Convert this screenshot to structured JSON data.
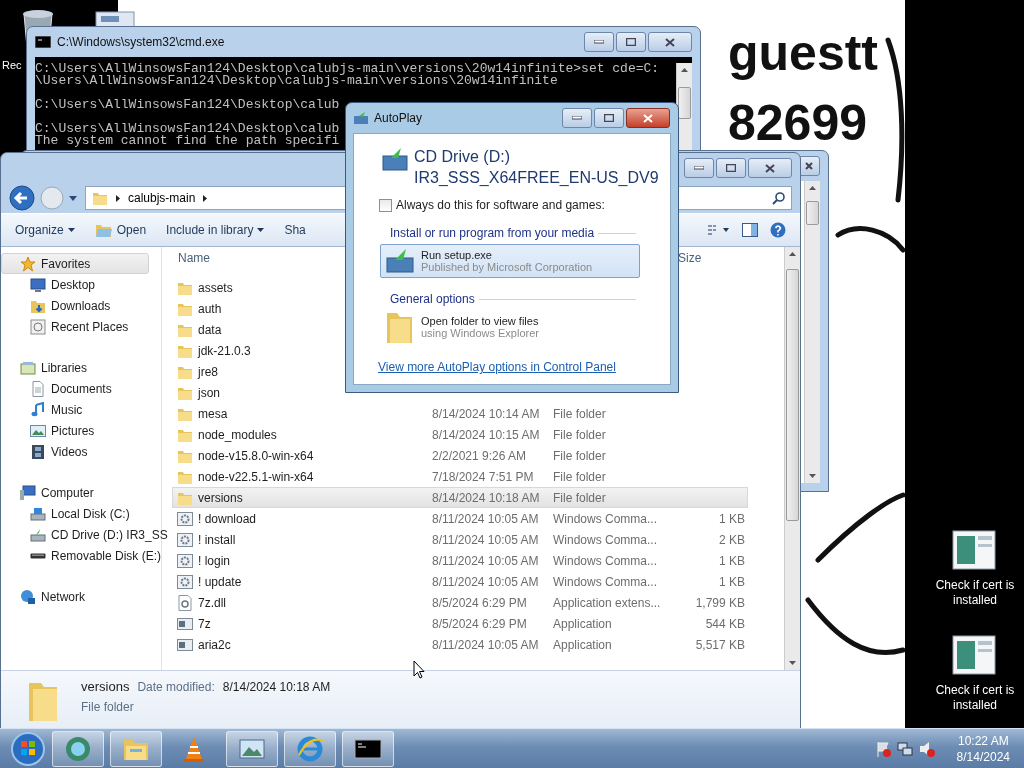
{
  "desktop": {
    "wallpaper_text": [
      "guestt",
      "82699"
    ],
    "left_icons": [
      {
        "label": "Rec"
      }
    ],
    "right_icons": [
      {
        "label": "Check if cert is installed"
      },
      {
        "label": "Check if cert is installed"
      }
    ]
  },
  "cmd_window": {
    "title": "C:\\Windows\\system32\\cmd.exe",
    "output": [
      {
        "lines": [
          "C:\\Users\\AllWinsowsFan124\\Desktop\\calubjs-main\\versions\\20w14infinite>set cde=C:",
          "\\Users\\AllWinsowsFan124\\Desktop\\calubjs-main\\versions\\20w14infinite"
        ]
      },
      {
        "lines": [
          "C:\\Users\\AllWinsowsFan124\\Desktop\\calub"
        ]
      },
      {
        "lines": [
          "C:\\Users\\AllWinsowsFan124\\Desktop\\calub",
          "The system cannot find the path specifi"
        ]
      }
    ]
  },
  "explorer": {
    "address": [
      "calubjs-main"
    ],
    "toolbar": [
      {
        "label": "Organize",
        "dropdown": true,
        "kind": "text"
      },
      {
        "label": "Open",
        "dropdown": false,
        "kind": "open"
      },
      {
        "label": "Include in library",
        "dropdown": true,
        "kind": "text"
      },
      {
        "label": "Sha",
        "dropdown": false,
        "kind": "text"
      }
    ],
    "nav": [
      {
        "label": "Favorites",
        "kind": "star",
        "selected": true,
        "children": [
          {
            "label": "Desktop",
            "kind": "desktop",
            "selected": false
          },
          {
            "label": "Downloads",
            "kind": "downloads",
            "selected": false
          },
          {
            "label": "Recent Places",
            "kind": "recent",
            "selected": false
          }
        ]
      },
      {
        "label": "Libraries",
        "kind": "libraries",
        "selected": false,
        "children": [
          {
            "label": "Documents",
            "kind": "documents",
            "selected": false
          },
          {
            "label": "Music",
            "kind": "music",
            "selected": false
          },
          {
            "label": "Pictures",
            "kind": "pictures",
            "selected": false
          },
          {
            "label": "Videos",
            "kind": "videos",
            "selected": false
          }
        ]
      },
      {
        "label": "Computer",
        "kind": "computer",
        "selected": false,
        "children": [
          {
            "label": "Local Disk (C:)",
            "kind": "disk",
            "selected": false
          },
          {
            "label": "CD Drive (D:) IR3_SS",
            "kind": "cd",
            "selected": false
          },
          {
            "label": "Removable Disk (E:)",
            "kind": "removable",
            "selected": false
          }
        ]
      },
      {
        "label": "Network",
        "kind": "network",
        "selected": false
      }
    ],
    "columns": [
      {
        "label": "Name"
      },
      {
        "label": "Size"
      }
    ],
    "rows": [
      {
        "name": "assets",
        "kind": "folder",
        "selected": false
      },
      {
        "name": "auth",
        "kind": "folder",
        "selected": false
      },
      {
        "name": "data",
        "kind": "folder",
        "selected": false
      },
      {
        "name": "jdk-21.0.3",
        "kind": "folder",
        "selected": false
      },
      {
        "name": "jre8",
        "kind": "folder",
        "selected": false
      },
      {
        "name": "json",
        "kind": "folder",
        "selected": false
      },
      {
        "name": "mesa",
        "kind": "folder",
        "modified": "8/14/2024 10:14 AM",
        "type": "File folder",
        "selected": false
      },
      {
        "name": "node_modules",
        "kind": "folder",
        "modified": "8/14/2024 10:15 AM",
        "type": "File folder",
        "selected": false
      },
      {
        "name": "node-v15.8.0-win-x64",
        "kind": "folder",
        "modified": "2/2/2021 9:26 AM",
        "type": "File folder",
        "selected": false
      },
      {
        "name": "node-v22.5.1-win-x64",
        "kind": "folder",
        "modified": "7/18/2024 7:51 PM",
        "type": "File folder",
        "selected": false
      },
      {
        "name": "versions",
        "kind": "folder",
        "modified": "8/14/2024 10:18 AM",
        "type": "File folder",
        "selected": true
      },
      {
        "name": "! download",
        "kind": "script",
        "modified": "8/11/2024 10:05 AM",
        "type": "Windows Comma...",
        "size": "1 KB",
        "selected": false
      },
      {
        "name": "! install",
        "kind": "script",
        "modified": "8/11/2024 10:05 AM",
        "type": "Windows Comma...",
        "size": "2 KB",
        "selected": false
      },
      {
        "name": "! login",
        "kind": "script",
        "modified": "8/11/2024 10:05 AM",
        "type": "Windows Comma...",
        "size": "1 KB",
        "selected": false
      },
      {
        "name": "! update",
        "kind": "script",
        "modified": "8/11/2024 10:05 AM",
        "type": "Windows Comma...",
        "size": "1 KB",
        "selected": false
      },
      {
        "name": "7z.dll",
        "kind": "dll",
        "modified": "8/5/2024 6:29 PM",
        "type": "Application extens...",
        "size": "1,799 KB",
        "selected": false
      },
      {
        "name": "7z",
        "kind": "app",
        "modified": "8/5/2024 6:29 PM",
        "type": "Application",
        "size": "544 KB",
        "selected": false
      },
      {
        "name": "aria2c",
        "kind": "app",
        "modified": "8/11/2024 10:05 AM",
        "type": "Application",
        "size": "5,517 KB",
        "selected": false
      }
    ],
    "details": {
      "name": "versions",
      "label": "Date modified:",
      "value": "8/14/2024 10:18 AM",
      "type": "File folder"
    }
  },
  "autoplay": {
    "title": "AutoPlay",
    "drive": "CD Drive (D:)",
    "volume": "IR3_SSS_X64FREE_EN-US_DV9",
    "always": {
      "label": "Always do this for software and games:",
      "checked": false
    },
    "sections": [
      {
        "heading": "Install or run program from your media",
        "options": [
          {
            "title": "Run setup.exe",
            "subtitle": "Published by Microsoft Corporation",
            "kind": "setup",
            "selected": true
          }
        ]
      },
      {
        "heading": "General options",
        "options": [
          {
            "title": "Open folder to view files",
            "subtitle": "using Windows Explorer",
            "kind": "folder",
            "selected": false
          }
        ]
      }
    ],
    "link": "View more AutoPlay options in Control Panel"
  },
  "taskbar": {
    "buttons": [
      {
        "kind": "browser",
        "running": true
      },
      {
        "kind": "explorer",
        "running": true
      },
      {
        "kind": "vlc",
        "running": false
      },
      {
        "kind": "photo",
        "running": true
      },
      {
        "kind": "ie",
        "running": true
      },
      {
        "kind": "cmd",
        "running": true
      }
    ],
    "clock": {
      "time": "10:22 AM",
      "date": "8/14/2024"
    }
  }
}
